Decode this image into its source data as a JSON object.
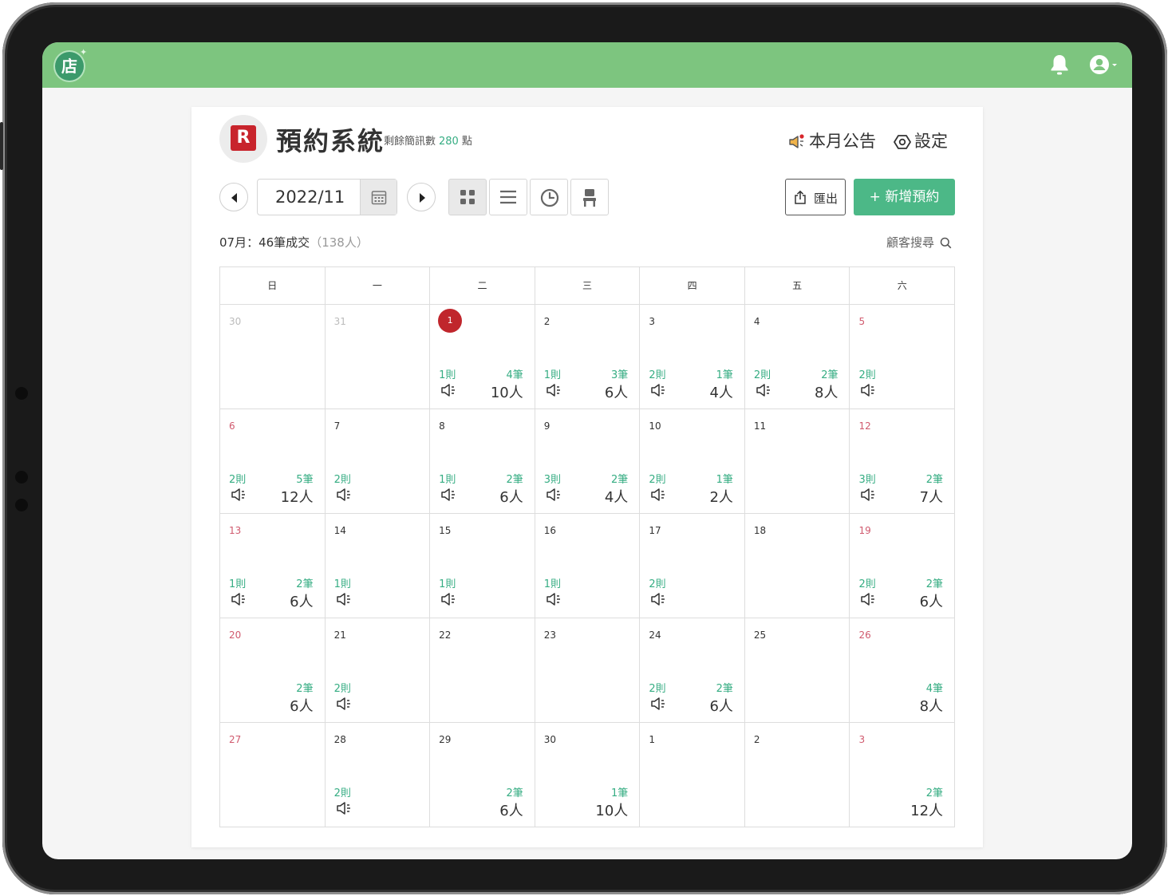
{
  "app": {
    "title": "預約系統",
    "sms_label": "剩餘簡訊數",
    "sms_points": "280",
    "sms_unit": "點",
    "logo_glyph": "店",
    "app_logo_glyph": "R",
    "notice_label": "本月公告",
    "settings_label": "設定"
  },
  "toolbar": {
    "date": "2022/11",
    "export_label": "匯出",
    "add_label": "+ 新增預約"
  },
  "summary": {
    "text": "07月：46筆成交",
    "count": "（138人）",
    "search_label": "顧客搜尋"
  },
  "colors": {
    "topbar": "#7dc57f",
    "accent": "#4cb887",
    "accent_text": "#36ad83",
    "today": "#c0262c",
    "weekend": "#d05a6e"
  },
  "calendar": {
    "weekdays": [
      "日",
      "一",
      "二",
      "三",
      "四",
      "五",
      "六"
    ],
    "weeks": [
      [
        {
          "day": "30",
          "type": "other"
        },
        {
          "day": "31",
          "type": "other"
        },
        {
          "day": "1",
          "type": "today",
          "ann": "1則",
          "bk": "4筆",
          "ppl": "10人",
          "spk": true
        },
        {
          "day": "2",
          "ann": "1則",
          "bk": "3筆",
          "ppl": "6人",
          "spk": true
        },
        {
          "day": "3",
          "ann": "2則",
          "bk": "1筆",
          "ppl": "4人",
          "spk": true
        },
        {
          "day": "4",
          "ann": "2則",
          "bk": "2筆",
          "ppl": "8人",
          "spk": true
        },
        {
          "day": "5",
          "type": "holiday",
          "ann": "2則",
          "spk": true
        }
      ],
      [
        {
          "day": "6",
          "type": "holiday",
          "ann": "2則",
          "bk": "5筆",
          "ppl": "12人",
          "spk": true
        },
        {
          "day": "7",
          "ann": "2則",
          "spk": true
        },
        {
          "day": "8",
          "ann": "1則",
          "bk": "2筆",
          "ppl": "6人",
          "spk": true
        },
        {
          "day": "9",
          "ann": "3則",
          "bk": "2筆",
          "ppl": "4人",
          "spk": true
        },
        {
          "day": "10",
          "ann": "2則",
          "bk": "1筆",
          "ppl": "2人",
          "spk": true
        },
        {
          "day": "11"
        },
        {
          "day": "12",
          "type": "holiday",
          "ann": "3則",
          "bk": "2筆",
          "ppl": "7人",
          "spk": true
        }
      ],
      [
        {
          "day": "13",
          "type": "holiday",
          "ann": "1則",
          "bk": "2筆",
          "ppl": "6人",
          "spk": true
        },
        {
          "day": "14",
          "ann": "1則",
          "spk": true
        },
        {
          "day": "15",
          "ann": "1則",
          "spk": true
        },
        {
          "day": "16",
          "ann": "1則",
          "spk": true
        },
        {
          "day": "17",
          "ann": "2則",
          "spk": true
        },
        {
          "day": "18"
        },
        {
          "day": "19",
          "type": "holiday",
          "ann": "2則",
          "bk": "2筆",
          "ppl": "6人",
          "spk": true
        }
      ],
      [
        {
          "day": "20",
          "type": "holiday",
          "bk": "2筆",
          "ppl": "6人"
        },
        {
          "day": "21",
          "ann": "2則",
          "spk": true
        },
        {
          "day": "22"
        },
        {
          "day": "23"
        },
        {
          "day": "24",
          "ann": "2則",
          "bk": "2筆",
          "ppl": "6人",
          "spk": true
        },
        {
          "day": "25"
        },
        {
          "day": "26",
          "type": "holiday",
          "bk": "4筆",
          "ppl": "8人"
        }
      ],
      [
        {
          "day": "27",
          "type": "holiday"
        },
        {
          "day": "28",
          "ann": "2則",
          "spk": true
        },
        {
          "day": "29",
          "bk": "2筆",
          "ppl": "6人"
        },
        {
          "day": "30",
          "bk": "1筆",
          "ppl": "10人"
        },
        {
          "day": "1"
        },
        {
          "day": "2"
        },
        {
          "day": "3",
          "type": "holiday",
          "bk": "2筆",
          "ppl": "12人"
        }
      ]
    ]
  }
}
